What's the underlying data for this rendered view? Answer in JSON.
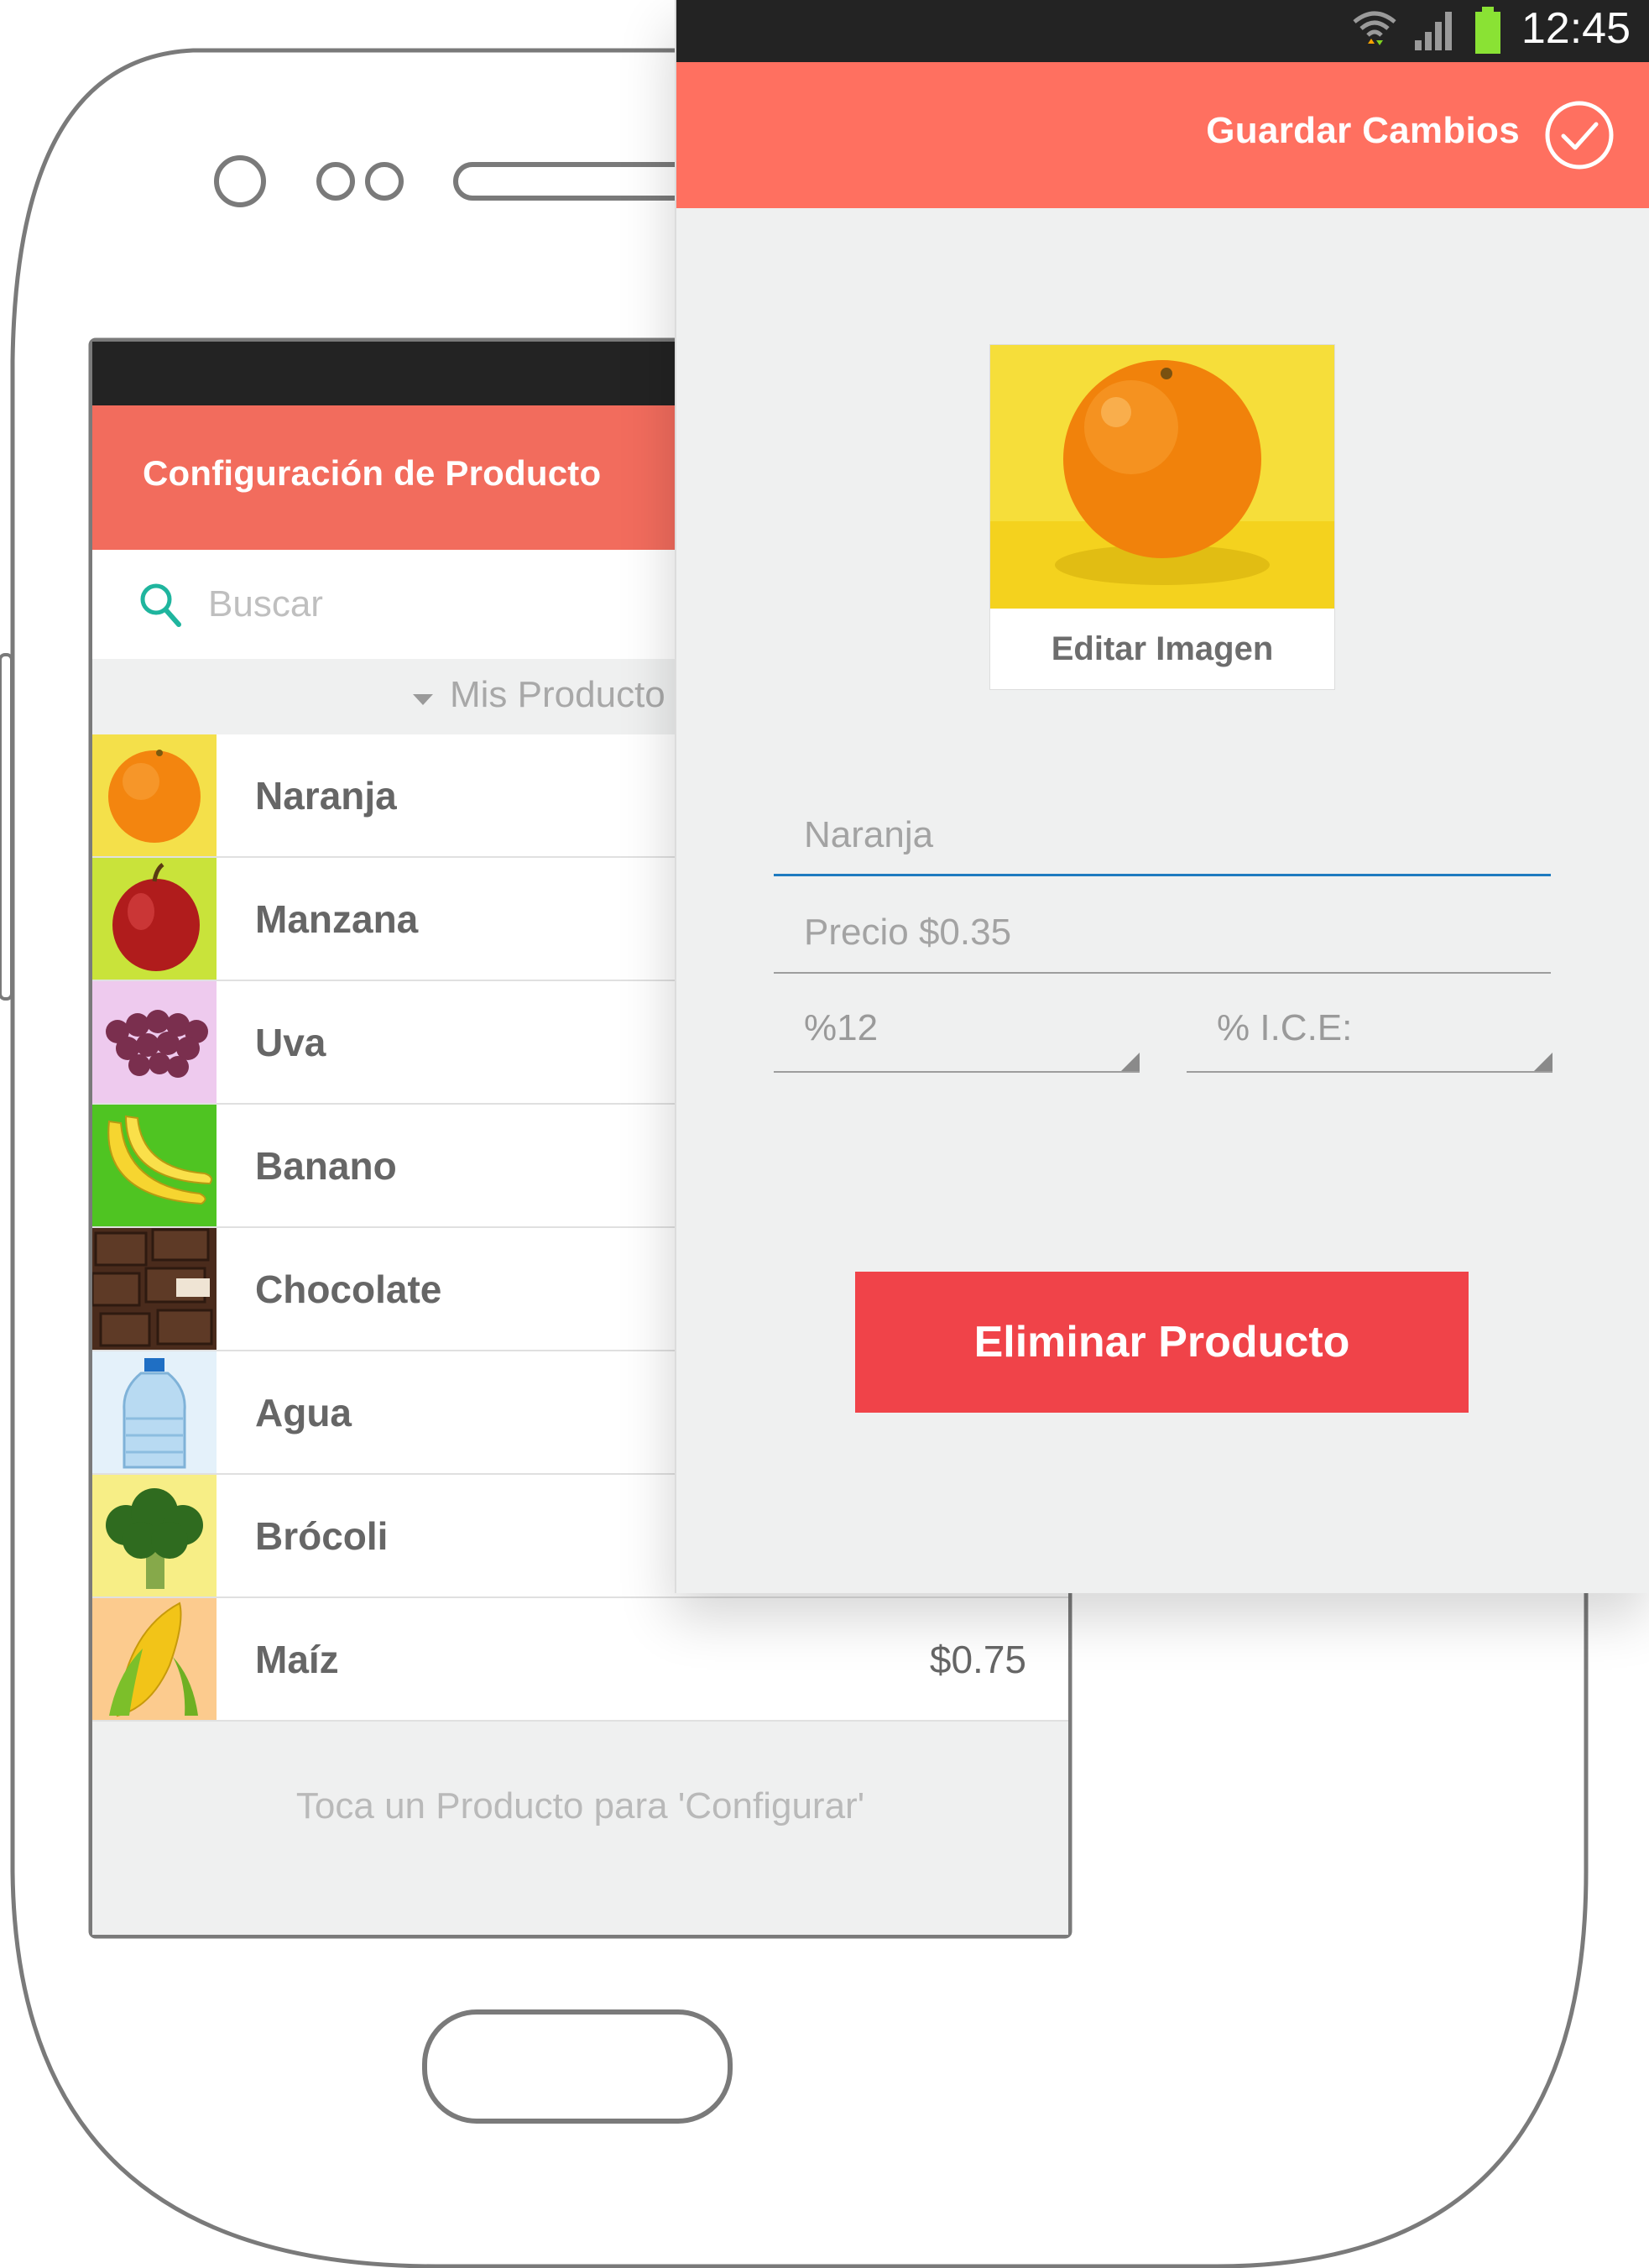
{
  "back_screen": {
    "title": "Configuración de Producto",
    "search": {
      "placeholder": "Buscar"
    },
    "section_label": "Mis Producto",
    "products": [
      {
        "name": "Naranja",
        "price": "",
        "image": "orange-image"
      },
      {
        "name": "Manzana",
        "price": "",
        "image": "apple-image"
      },
      {
        "name": "Uva",
        "price": "",
        "image": "grapes-image"
      },
      {
        "name": "Banano",
        "price": "",
        "image": "banana-image"
      },
      {
        "name": "Chocolate",
        "price": "",
        "image": "chocolate-image"
      },
      {
        "name": "Agua",
        "price": "",
        "image": "water-bottle-image"
      },
      {
        "name": "Brócoli",
        "price": "",
        "image": "broccoli-image"
      },
      {
        "name": "Maíz",
        "price": "$0.75",
        "image": "corn-image"
      }
    ],
    "hint": "Toca un Producto para 'Configurar'"
  },
  "front_screen": {
    "status_bar": {
      "time": "12:45"
    },
    "save_label": "Guardar Cambios",
    "edit_image_label": "Editar Imagen",
    "name_field": {
      "placeholder": "Naranja"
    },
    "price_field": {
      "placeholder": "Precio $0.35"
    },
    "tax_select": {
      "value": "%12"
    },
    "ice_select": {
      "value": "% I.C.E:"
    },
    "delete_label": "Eliminar Producto"
  },
  "colors": {
    "appbar_front": "#ff7060",
    "appbar_back": "#f26c5d",
    "delete": "#f04349",
    "search_icon": "#1fb59e",
    "input_active": "#1e7bc0",
    "battery": "#8ae234"
  }
}
